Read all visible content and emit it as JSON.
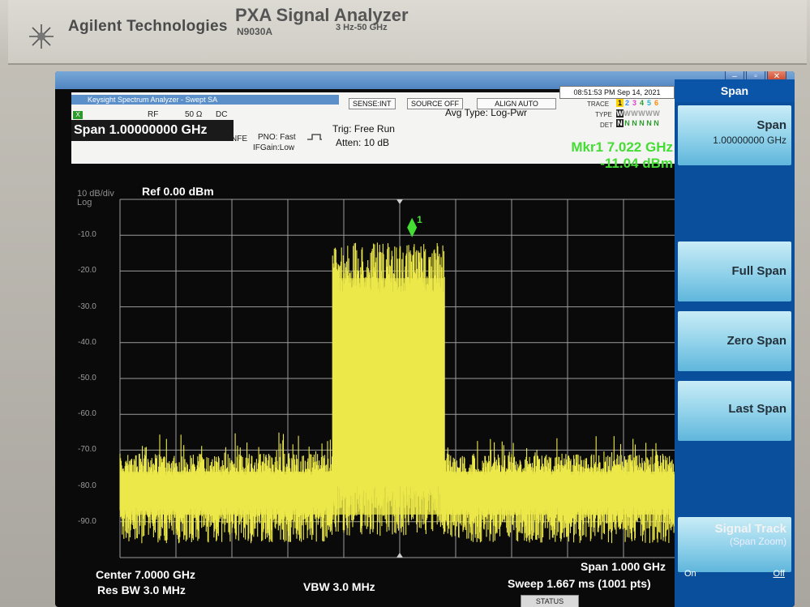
{
  "instrument": {
    "brand": "Agilent Technologies",
    "model": "PXA Signal Analyzer",
    "model_number": "N9030A",
    "freq_range": "3 Hz-50 GHz"
  },
  "window": {
    "title": "Keysight Spectrum Analyzer - Swept SA",
    "minimize": "–",
    "maximize": "▫",
    "close": "✕"
  },
  "status": {
    "rf": "RF",
    "impedance": "50 Ω",
    "coupling": "DC",
    "sense": "SENSE:INT",
    "source": "SOURCE OFF",
    "align": "ALIGN AUTO",
    "time": "08:51:53 PM Sep 14, 2021",
    "avg_type": "Avg Type: Log-Pwr",
    "trace_label": "TRACE",
    "trace_nums": [
      "1",
      "2",
      "3",
      "4",
      "5",
      "6"
    ],
    "type_label": "TYPE",
    "type_values": [
      "W",
      "W",
      "W",
      "W",
      "W",
      "W"
    ],
    "det_label": "DET",
    "det_values": [
      "N",
      "N",
      "N",
      "N",
      "N",
      "N"
    ],
    "nfe": "NFE",
    "pno": "PNO: Fast",
    "ifgain": "IFGain:Low",
    "trig": "Trig: Free Run",
    "atten": "Atten: 10 dB",
    "span_header": "Span 1.00000000 GHz",
    "badge": "X"
  },
  "marker": {
    "freq": "Mkr1 7.022 GHz",
    "amp": "-11.04 dBm",
    "label": "1"
  },
  "display": {
    "scale": "10 dB/div",
    "scale_type": "Log",
    "ref_level": "Ref 0.00 dBm",
    "y_ticks": [
      "-10.0",
      "-20.0",
      "-30.0",
      "-40.0",
      "-50.0",
      "-60.0",
      "-70.0",
      "-80.0",
      "-90.0"
    ]
  },
  "bottom": {
    "center": "Center 7.0000 GHz",
    "res_bw": "Res BW 3.0 MHz",
    "vbw": "VBW 3.0 MHz",
    "span": "Span 1.000 GHz",
    "sweep": "Sweep  1.667 ms (1001 pts)"
  },
  "softkeys": {
    "menu_title": "Span",
    "span_label": "Span",
    "span_value": "1.00000000 GHz",
    "full_span": "Full Span",
    "zero_span": "Zero Span",
    "last_span": "Last Span",
    "signal_track": "Signal Track",
    "signal_track_sub": "(Span Zoom)",
    "on": "On",
    "off": "Off"
  },
  "status_bar": "STATUS",
  "colors": {
    "trace": "#ece84a",
    "marker": "#44dd33",
    "grid": "#9c9c9c",
    "softkey_bg": "#8fd1ea",
    "panel_bg": "#0a4f9b"
  },
  "chart_data": {
    "type": "line",
    "x_start_ghz": 6.5,
    "x_stop_ghz": 7.5,
    "ylim": [
      -100,
      0
    ],
    "y_unit": "dBm",
    "grid": true,
    "noise_floor_dbm": -75,
    "noise_floor_min_dbm": -96,
    "signal_band_ghz": [
      6.88,
      7.08
    ],
    "signal_peak_dbm": -10,
    "marker_ghz": 7.022,
    "marker_dbm": -11.04,
    "points": 1001
  }
}
